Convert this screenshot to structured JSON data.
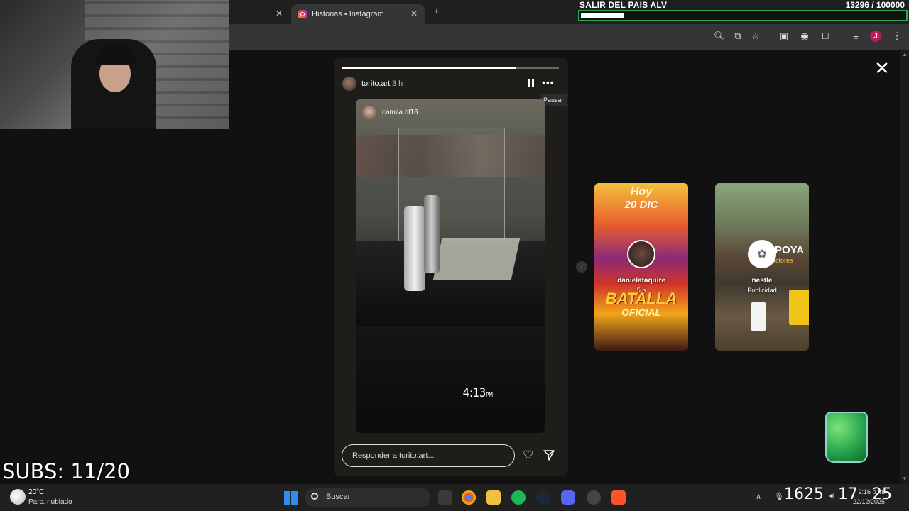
{
  "browser": {
    "tabs": [
      {
        "label": "",
        "active": false
      },
      {
        "label": "Historias • Instagram",
        "active": true
      }
    ],
    "new_tab": "+",
    "avatar_initial": "J"
  },
  "goal": {
    "title": "SALIR DEL PAIS ALV",
    "count": "13296  / 100000",
    "progress": 0.133
  },
  "story": {
    "username": "torito.art",
    "time": "3 h",
    "progress": 0.8,
    "tooltip": "Pausar",
    "shared_username": "camila.bl16",
    "clock_time": "4:13",
    "clock_suffix": "PM",
    "reply_placeholder": "Responder a torito.art..."
  },
  "previews": [
    {
      "name": "danielataquire",
      "meta": "5 h",
      "title_top": "Hoy",
      "title_date": "20 DIC",
      "title_main": "BATALLA",
      "title_sub": "OFICIAL"
    },
    {
      "name": "nestle",
      "meta": "Publicidad",
      "brand": "POYA",
      "brand_sub": "actores"
    }
  ],
  "overlay": {
    "subs": "SUBS: 11/20"
  },
  "taskbar": {
    "weather_temp": "20°C",
    "weather_desc": "Parc. nublado",
    "search": "Buscar",
    "time_big_1": "16",
    "time_big_2": "25",
    "time_big_3": "17",
    "time_big_4": "25",
    "sys_time": "9:16 p.m.",
    "sys_date": "22/12/2025"
  },
  "icons": [
    "close-icon",
    "plus-icon",
    "zoom-icon",
    "cast-icon",
    "star-icon",
    "extension-icon",
    "menu-icon",
    "pause-icon",
    "more-icon",
    "heart-icon",
    "send-icon",
    "chevron-right-icon",
    "windows-icon",
    "search-icon"
  ]
}
